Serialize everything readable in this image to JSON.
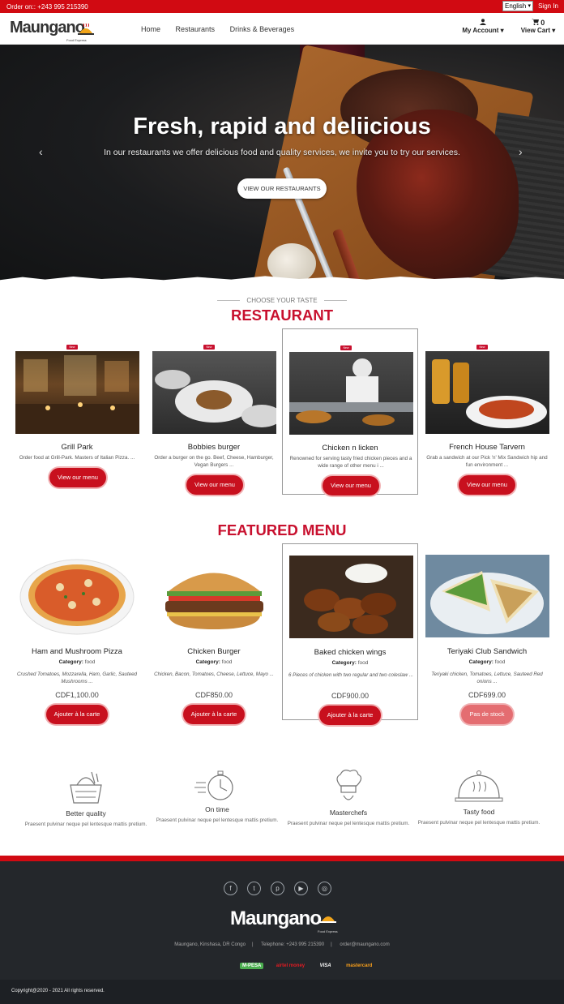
{
  "topbar": {
    "order": "Order on:: +243 995 215390",
    "language": "English",
    "signin": "Sign In"
  },
  "header": {
    "logo": "Maungano",
    "logo_sub": "Food Express",
    "nav": [
      "Home",
      "Restaurants",
      "Drinks & Beverages"
    ],
    "account": "My Account",
    "cart_count": "0",
    "cart": "View Cart"
  },
  "hero": {
    "title": "Fresh, rapid and deliicious",
    "tagline": "In our restaurants we offer delicious food and quality services, we invite you to try our services.",
    "cta": "VIEW OUR RESTAURANTS"
  },
  "restaurants_section": {
    "kicker": "CHOOSE YOUR TASTE",
    "title": "RESTAURANT",
    "badge": "New"
  },
  "restaurants": [
    {
      "name": "Grill Park",
      "desc": "Order food at Grill-Park. Masters of Italian Pizza. ...",
      "button": "View our menu"
    },
    {
      "name": "Bobbies burger",
      "desc": "Order a burger on the go. Beef, Cheese, Hamburger, Vegan Burgers ...",
      "button": "View our menu"
    },
    {
      "name": "Chicken n licken",
      "desc": "Renowned for serving tasty fried chicken pieces and a wide range of other menu i ...",
      "button": "View our menu"
    },
    {
      "name": "French House Tarvern",
      "desc": "Grab a sandwich at our Pick 'n' Mix Sandwich hip and fun environment ...",
      "button": "View our menu"
    }
  ],
  "featured_section": {
    "title": "FEATURED MENU",
    "category_label": "Category:"
  },
  "featured": [
    {
      "name": "Ham and Mushroom Pizza",
      "category": "food",
      "ingredients": "Crushed Tomatoes, Mozzarella, Ham, Garlic, Sauteed Mushrooms ...",
      "price": "CDF1,100.00",
      "button": "Ajouter à la carte"
    },
    {
      "name": "Chicken Burger",
      "category": "food",
      "ingredients": "Chicken, Bacon, Tomatoes, Cheese, Lettuce, Mayo ...",
      "price": "CDF850.00",
      "button": "Ajouter à la carte"
    },
    {
      "name": "Baked chicken wings",
      "category": "food",
      "ingredients": "6 Pieces of chicken with two regular and two coleslaw ...",
      "price": "CDF900.00",
      "button": "Ajouter à la carte"
    },
    {
      "name": "Teriyaki Club Sandwich",
      "category": "food",
      "ingredients": "Teriyaki chicken, Tomatoes, Lettuce, Sauteed Red onions ...",
      "price": "CDF699.00",
      "button": "Pas de stock"
    }
  ],
  "features": [
    {
      "title": "Better quality",
      "desc": "Praesent pulvinar neque pel lentesque mattis pretium."
    },
    {
      "title": "On time",
      "desc": "Praesent pulvinar neque pel lentesque mattis pretium."
    },
    {
      "title": "Masterchefs",
      "desc": "Praesent pulvinar neque pel lentesque mattis pretium."
    },
    {
      "title": "Tasty food",
      "desc": "Praesent pulvinar neque pel lentesque mattis pretium."
    }
  ],
  "footer": {
    "logo": "Maungano",
    "logo_sub": "Food Express",
    "address": "Maungano, Kinshasa, DR Congo",
    "phone": "Telephone: +243 995 215390",
    "email": "order@maungano.com",
    "payments": [
      "M-PESA",
      "airtel money",
      "VISA",
      "mastercard"
    ],
    "copyright": "Copyright@2020 - 2021 All rights reserved."
  },
  "colors": {
    "brand_red": "#d10a12",
    "title_red": "#c8102e",
    "footer_bg": "#24272b"
  }
}
